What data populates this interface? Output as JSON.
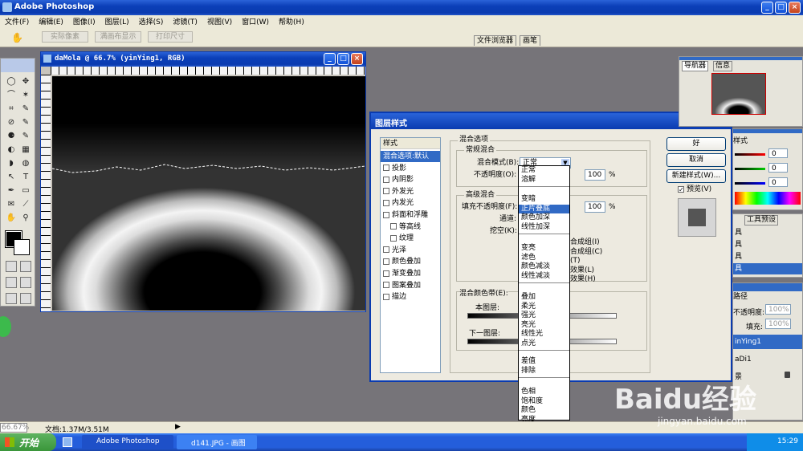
{
  "app": {
    "title": "Adobe Photoshop",
    "window_min": "_",
    "window_max": "□",
    "window_close": "×"
  },
  "menu": [
    "文件(F)",
    "编辑(E)",
    "图像(I)",
    "图层(L)",
    "选择(S)",
    "滤镜(T)",
    "视图(V)",
    "窗口(W)",
    "帮助(H)"
  ],
  "options": {
    "btn1": "实际像素",
    "btn2": "满画布显示",
    "btn3": "打印尺寸",
    "tab1": "文件浏览器",
    "tab2": "画笔"
  },
  "document": {
    "title": "daMola @ 66.7% (yinYing1, RGB)",
    "zoom": "66.67%",
    "doc_info": "文档:1.37M/3.51M"
  },
  "dialog": {
    "title": "图层样式",
    "styles_header": "样式",
    "styles": [
      {
        "label": "混合选项:默认",
        "checkbox": false,
        "selected": true,
        "indent": false
      },
      {
        "label": "投影",
        "checkbox": true,
        "indent": false
      },
      {
        "label": "内阴影",
        "checkbox": true,
        "indent": false
      },
      {
        "label": "外发光",
        "checkbox": true,
        "indent": false
      },
      {
        "label": "内发光",
        "checkbox": true,
        "indent": false
      },
      {
        "label": "斜面和浮雕",
        "checkbox": true,
        "indent": false
      },
      {
        "label": "等高线",
        "checkbox": true,
        "indent": true
      },
      {
        "label": "纹理",
        "checkbox": true,
        "indent": true
      },
      {
        "label": "光泽",
        "checkbox": true,
        "indent": false
      },
      {
        "label": "颜色叠加",
        "checkbox": true,
        "indent": false
      },
      {
        "label": "渐变叠加",
        "checkbox": true,
        "indent": false
      },
      {
        "label": "图案叠加",
        "checkbox": true,
        "indent": false
      },
      {
        "label": "描边",
        "checkbox": true,
        "indent": false
      }
    ],
    "blend_options_title": "混合选项",
    "general_blend": "常规混合",
    "blend_mode_label": "混合模式(B):",
    "blend_mode_value": "正常",
    "opacity_label": "不透明度(O):",
    "opacity_value": "100",
    "percent": "%",
    "advanced_blend": "高级混合",
    "fill_opacity_label": "填充不透明度(F):",
    "fill_opacity_value": "100",
    "channels_label": "通道:",
    "knockout_label": "挖空(K):",
    "partial_options": [
      "合成组(I)",
      "合成组(C)",
      "(T)",
      "效果(L)",
      "效果(H)"
    ],
    "blend_if_label": "混合颜色带(E):",
    "this_layer_label": "本图层:",
    "underlying_label": "下一图层:",
    "ok": "好",
    "cancel": "取消",
    "new_style": "新建样式(W)...",
    "preview": "预览(V)",
    "blend_groups": [
      [
        "正常",
        "溶解"
      ],
      [
        "变暗",
        "正片叠底",
        "颜色加深",
        "线性加深"
      ],
      [
        "变亮",
        "滤色",
        "颜色减淡",
        "线性减淡"
      ],
      [
        "叠加",
        "柔光",
        "强光",
        "亮光",
        "线性光",
        "点光"
      ],
      [
        "差值",
        "排除"
      ],
      [
        "色相",
        "饱和度",
        "颜色",
        "亮度"
      ]
    ],
    "highlighted": "正片叠底"
  },
  "navigator": {
    "tab1": "导航器",
    "tab2": "信息"
  },
  "color_panel": {
    "tab": "样式",
    "v1": "0",
    "v2": "0",
    "v3": "0"
  },
  "tool_presets": {
    "tab": "工具预设",
    "items": [
      "具",
      "具",
      "具",
      "具"
    ]
  },
  "layers": {
    "tab": "路径",
    "opacity_label": "不透明度:",
    "opacity_value": "100%",
    "fill_label": "填充:",
    "fill_value": "100%",
    "items": [
      "inYing1",
      "aDi1",
      "景"
    ]
  },
  "taskbar": {
    "start": "开始",
    "task1": "Adobe Photoshop",
    "task2": "d141.JPG - 画图",
    "time": "15:29"
  },
  "watermark": {
    "text": "Baidu经验",
    "url": "jingyan.baidu.com"
  },
  "colors": {
    "xp_blue": "#0a3bb0",
    "dialog_bg": "#edeae0",
    "highlight": "#316ac5"
  }
}
